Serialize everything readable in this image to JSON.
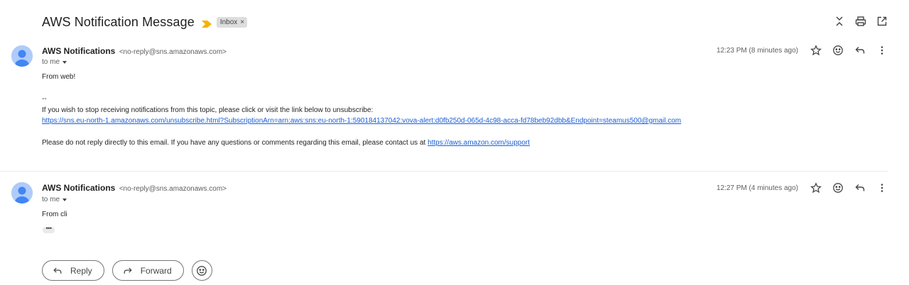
{
  "thread": {
    "subject": "AWS Notification Message",
    "label": "Inbox",
    "label_remove": "×"
  },
  "header_icons": [
    "expand-collapse-icon",
    "print-icon",
    "open-in-new-window-icon"
  ],
  "messages": [
    {
      "sender_name": "AWS Notifications",
      "sender_email": "<no-reply@sns.amazonaws.com>",
      "to": "to me",
      "timestamp": "12:23 PM (8 minutes ago)",
      "body": {
        "line1": "From web!",
        "signature": "--",
        "unsubscribe_text": "If you wish to stop receiving notifications from this topic, please click or visit the link below to unsubscribe:",
        "unsubscribe_link": "https://sns.eu-north-1.amazonaws.com/unsubscribe.html?SubscriptionArn=arn:aws:sns:eu-north-1:590184137042:vova-alert:d0fb250d-065d-4c98-acca-fd78beb92dbb&Endpoint=steamus500@gmail.com",
        "contact_text": "Please do not reply directly to this email. If you have any questions or comments regarding this email, please contact us at ",
        "contact_link": "https://aws.amazon.com/support"
      }
    },
    {
      "sender_name": "AWS Notifications",
      "sender_email": "<no-reply@sns.amazonaws.com>",
      "to": "to me",
      "timestamp": "12:27 PM (4 minutes ago)",
      "body": {
        "line1": "From cli",
        "trimmed": "•••"
      }
    }
  ],
  "actions": {
    "reply": "Reply",
    "forward": "Forward"
  },
  "colors": {
    "link": "#1a5fd6",
    "importance": "#f4b400",
    "avatar_bg": "#aecbfa",
    "avatar_fg": "#4285f4"
  }
}
